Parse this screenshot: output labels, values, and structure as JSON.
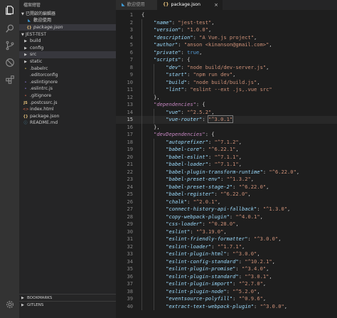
{
  "sidebar": {
    "title": "檔案總管",
    "open_editors": {
      "label": "已開啟的編輯器",
      "items": [
        {
          "label": "歡迎使用",
          "icon": "vscode-logo-icon"
        },
        {
          "label": "package.json",
          "icon": "json-braces-icon"
        }
      ]
    },
    "project": {
      "label": "JEST-TEST",
      "items": [
        {
          "label": "build",
          "kind": "folder"
        },
        {
          "label": "config",
          "kind": "folder"
        },
        {
          "label": "src",
          "kind": "folder"
        },
        {
          "label": "static",
          "kind": "folder"
        },
        {
          "label": ".babelrc",
          "kind": "file"
        },
        {
          "label": ".editorconfig",
          "kind": "file"
        },
        {
          "label": ".eslintignore",
          "kind": "file"
        },
        {
          "label": ".eslintrc.js",
          "kind": "file"
        },
        {
          "label": ".gitignore",
          "kind": "file"
        },
        {
          "label": ".postcssrc.js",
          "kind": "file"
        },
        {
          "label": "index.html",
          "kind": "file"
        },
        {
          "label": "package.json",
          "kind": "file"
        },
        {
          "label": "README.md",
          "kind": "file"
        }
      ]
    },
    "bookmarks_label": "BOOKMARKS",
    "gitlens_label": "GITLENS"
  },
  "tabs": [
    {
      "label": "歡迎使用",
      "active": false
    },
    {
      "label": "package.json",
      "active": true
    }
  ],
  "editor": {
    "current_line": 15,
    "lines": [
      {
        "n": "1",
        "indent": 0,
        "parts": [
          [
            "p",
            "{"
          ]
        ]
      },
      {
        "n": "2",
        "indent": 1,
        "parts": [
          [
            "k",
            "\"name\""
          ],
          [
            "p",
            ": "
          ],
          [
            "s",
            "\"jest-test\""
          ],
          [
            "p",
            ","
          ]
        ]
      },
      {
        "n": "3",
        "indent": 1,
        "parts": [
          [
            "k",
            "\"version\""
          ],
          [
            "p",
            ": "
          ],
          [
            "s",
            "\"1.0.0\""
          ],
          [
            "p",
            ","
          ]
        ]
      },
      {
        "n": "4",
        "indent": 1,
        "parts": [
          [
            "k",
            "\"description\""
          ],
          [
            "p",
            ": "
          ],
          [
            "s",
            "\"A Vue.js project\""
          ],
          [
            "p",
            ","
          ]
        ]
      },
      {
        "n": "5",
        "indent": 1,
        "parts": [
          [
            "k",
            "\"author\""
          ],
          [
            "p",
            ": "
          ],
          [
            "s",
            "\"anson <kinanson@gmail.com>\""
          ],
          [
            "p",
            ","
          ]
        ]
      },
      {
        "n": "6",
        "indent": 1,
        "parts": [
          [
            "k",
            "\"private\""
          ],
          [
            "p",
            ": "
          ],
          [
            "b",
            "true"
          ],
          [
            "p",
            ","
          ]
        ]
      },
      {
        "n": "7",
        "indent": 1,
        "parts": [
          [
            "k",
            "\"scripts\""
          ],
          [
            "p",
            ": {"
          ]
        ]
      },
      {
        "n": "8",
        "indent": 2,
        "parts": [
          [
            "k",
            "\"dev\""
          ],
          [
            "p",
            ": "
          ],
          [
            "s",
            "\"node build/dev-server.js\""
          ],
          [
            "p",
            ","
          ]
        ]
      },
      {
        "n": "9",
        "indent": 2,
        "parts": [
          [
            "k",
            "\"start\""
          ],
          [
            "p",
            ": "
          ],
          [
            "s",
            "\"npm run dev\""
          ],
          [
            "p",
            ","
          ]
        ]
      },
      {
        "n": "10",
        "indent": 2,
        "parts": [
          [
            "k",
            "\"build\""
          ],
          [
            "p",
            ": "
          ],
          [
            "s",
            "\"node build/build.js\""
          ],
          [
            "p",
            ","
          ]
        ]
      },
      {
        "n": "11",
        "indent": 2,
        "parts": [
          [
            "k",
            "\"lint\""
          ],
          [
            "p",
            ": "
          ],
          [
            "s",
            "\"eslint --ext .js,.vue src\""
          ]
        ]
      },
      {
        "n": "12",
        "indent": 1,
        "parts": [
          [
            "p",
            "},"
          ]
        ]
      },
      {
        "n": "13",
        "indent": 1,
        "parts": [
          [
            "k2",
            "\"dependencies\""
          ],
          [
            "p",
            ": {"
          ]
        ]
      },
      {
        "n": "14",
        "indent": 2,
        "parts": [
          [
            "k",
            "\"vue\""
          ],
          [
            "p",
            ": "
          ],
          [
            "s",
            "\"^2.5.2\""
          ],
          [
            "p",
            ","
          ]
        ]
      },
      {
        "n": "15",
        "indent": 2,
        "parts": [
          [
            "k",
            "\"vue-router\""
          ],
          [
            "p",
            ": "
          ],
          [
            "s",
            "\"^3.0.1\""
          ]
        ]
      },
      {
        "n": "16",
        "indent": 1,
        "parts": [
          [
            "p",
            "},"
          ]
        ]
      },
      {
        "n": "17",
        "indent": 1,
        "parts": [
          [
            "k2",
            "\"devDependencies\""
          ],
          [
            "p",
            ": {"
          ]
        ]
      },
      {
        "n": "18",
        "indent": 2,
        "parts": [
          [
            "k",
            "\"autoprefixer\""
          ],
          [
            "p",
            ": "
          ],
          [
            "s",
            "\"^7.1.2\""
          ],
          [
            "p",
            ","
          ]
        ]
      },
      {
        "n": "19",
        "indent": 2,
        "parts": [
          [
            "k",
            "\"babel-core\""
          ],
          [
            "p",
            ": "
          ],
          [
            "s",
            "\"^6.22.1\""
          ],
          [
            "p",
            ","
          ]
        ]
      },
      {
        "n": "20",
        "indent": 2,
        "parts": [
          [
            "k",
            "\"babel-eslint\""
          ],
          [
            "p",
            ": "
          ],
          [
            "s",
            "\"^7.1.1\""
          ],
          [
            "p",
            ","
          ]
        ]
      },
      {
        "n": "21",
        "indent": 2,
        "parts": [
          [
            "k",
            "\"babel-loader\""
          ],
          [
            "p",
            ": "
          ],
          [
            "s",
            "\"^7.1.1\""
          ],
          [
            "p",
            ","
          ]
        ]
      },
      {
        "n": "22",
        "indent": 2,
        "parts": [
          [
            "k",
            "\"babel-plugin-transform-runtime\""
          ],
          [
            "p",
            ": "
          ],
          [
            "s",
            "\"^6.22.0\""
          ],
          [
            "p",
            ","
          ]
        ]
      },
      {
        "n": "23",
        "indent": 2,
        "parts": [
          [
            "k",
            "\"babel-preset-env\""
          ],
          [
            "p",
            ": "
          ],
          [
            "s",
            "\"^1.3.2\""
          ],
          [
            "p",
            ","
          ]
        ]
      },
      {
        "n": "24",
        "indent": 2,
        "parts": [
          [
            "k",
            "\"babel-preset-stage-2\""
          ],
          [
            "p",
            ": "
          ],
          [
            "s",
            "\"^6.22.0\""
          ],
          [
            "p",
            ","
          ]
        ]
      },
      {
        "n": "25",
        "indent": 2,
        "parts": [
          [
            "k",
            "\"babel-register\""
          ],
          [
            "p",
            ": "
          ],
          [
            "s",
            "\"^6.22.0\""
          ],
          [
            "p",
            ","
          ]
        ]
      },
      {
        "n": "26",
        "indent": 2,
        "parts": [
          [
            "k",
            "\"chalk\""
          ],
          [
            "p",
            ": "
          ],
          [
            "s",
            "\"^2.0.1\""
          ],
          [
            "p",
            ","
          ]
        ]
      },
      {
        "n": "27",
        "indent": 2,
        "parts": [
          [
            "k",
            "\"connect-history-api-fallback\""
          ],
          [
            "p",
            ": "
          ],
          [
            "s",
            "\"^1.3.0\""
          ],
          [
            "p",
            ","
          ]
        ]
      },
      {
        "n": "28",
        "indent": 2,
        "parts": [
          [
            "k",
            "\"copy-webpack-plugin\""
          ],
          [
            "p",
            ": "
          ],
          [
            "s",
            "\"^4.0.1\""
          ],
          [
            "p",
            ","
          ]
        ]
      },
      {
        "n": "29",
        "indent": 2,
        "parts": [
          [
            "k",
            "\"css-loader\""
          ],
          [
            "p",
            ": "
          ],
          [
            "s",
            "\"^0.28.0\""
          ],
          [
            "p",
            ","
          ]
        ]
      },
      {
        "n": "30",
        "indent": 2,
        "parts": [
          [
            "k",
            "\"eslint\""
          ],
          [
            "p",
            ": "
          ],
          [
            "s",
            "\"^3.19.0\""
          ],
          [
            "p",
            ","
          ]
        ]
      },
      {
        "n": "31",
        "indent": 2,
        "parts": [
          [
            "k",
            "\"eslint-friendly-formatter\""
          ],
          [
            "p",
            ": "
          ],
          [
            "s",
            "\"^3.0.0\""
          ],
          [
            "p",
            ","
          ]
        ]
      },
      {
        "n": "32",
        "indent": 2,
        "parts": [
          [
            "k",
            "\"eslint-loader\""
          ],
          [
            "p",
            ": "
          ],
          [
            "s",
            "\"^1.7.1\""
          ],
          [
            "p",
            ","
          ]
        ]
      },
      {
        "n": "33",
        "indent": 2,
        "parts": [
          [
            "k",
            "\"eslint-plugin-html\""
          ],
          [
            "p",
            ": "
          ],
          [
            "s",
            "\"^3.0.0\""
          ],
          [
            "p",
            ","
          ]
        ]
      },
      {
        "n": "34",
        "indent": 2,
        "parts": [
          [
            "k",
            "\"eslint-config-standard\""
          ],
          [
            "p",
            ": "
          ],
          [
            "s",
            "\"^10.2.1\""
          ],
          [
            "p",
            ","
          ]
        ]
      },
      {
        "n": "35",
        "indent": 2,
        "parts": [
          [
            "k",
            "\"eslint-plugin-promise\""
          ],
          [
            "p",
            ": "
          ],
          [
            "s",
            "\"^3.4.0\""
          ],
          [
            "p",
            ","
          ]
        ]
      },
      {
        "n": "36",
        "indent": 2,
        "parts": [
          [
            "k",
            "\"eslint-plugin-standard\""
          ],
          [
            "p",
            ": "
          ],
          [
            "s",
            "\"^3.0.1\""
          ],
          [
            "p",
            ","
          ]
        ]
      },
      {
        "n": "37",
        "indent": 2,
        "parts": [
          [
            "k",
            "\"eslint-plugin-import\""
          ],
          [
            "p",
            ": "
          ],
          [
            "s",
            "\"^2.7.0\""
          ],
          [
            "p",
            ","
          ]
        ]
      },
      {
        "n": "38",
        "indent": 2,
        "parts": [
          [
            "k",
            "\"eslint-plugin-node\""
          ],
          [
            "p",
            ": "
          ],
          [
            "s",
            "\"^5.2.0\""
          ],
          [
            "p",
            ","
          ]
        ]
      },
      {
        "n": "39",
        "indent": 2,
        "parts": [
          [
            "k",
            "\"eventsource-polyfill\""
          ],
          [
            "p",
            ": "
          ],
          [
            "s",
            "\"^0.9.6\""
          ],
          [
            "p",
            ","
          ]
        ]
      },
      {
        "n": "40",
        "indent": 2,
        "parts": [
          [
            "k",
            "\"extract-text-webpack-plugin\""
          ],
          [
            "p",
            ": "
          ],
          [
            "s",
            "\"^3.0.0\""
          ],
          [
            "p",
            ","
          ]
        ]
      }
    ]
  },
  "activity_bar": [
    {
      "icon": "files-icon"
    },
    {
      "icon": "search-icon"
    },
    {
      "icon": "source-control-icon"
    },
    {
      "icon": "debug-icon"
    },
    {
      "icon": "extensions-icon"
    },
    {
      "icon": "gear-icon"
    }
  ]
}
